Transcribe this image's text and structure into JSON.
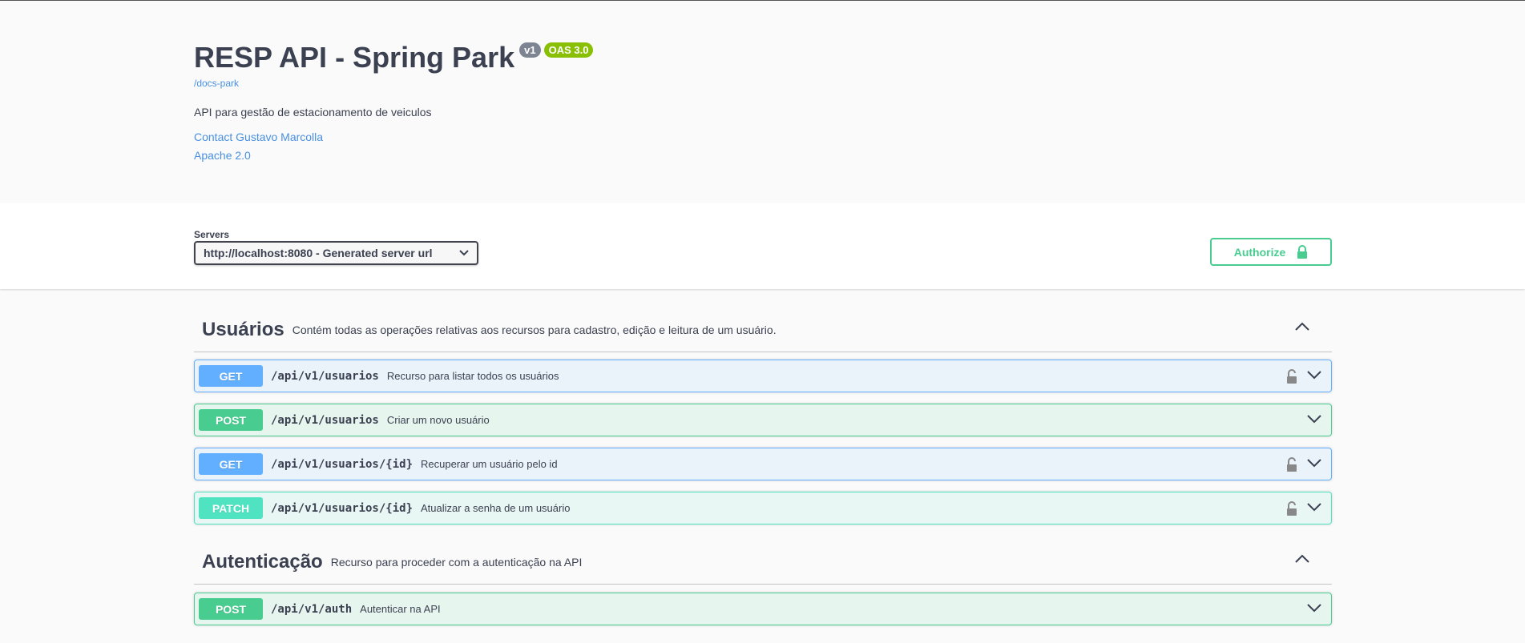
{
  "info": {
    "title": "RESP API - Spring Park",
    "version_badge": "v1",
    "oas_badge": "OAS 3.0",
    "base_url": "/docs-park",
    "description": "API para gestão de estacionamento de veiculos",
    "contact_link": "Contact Gustavo Marcolla",
    "license_link": "Apache 2.0"
  },
  "servers": {
    "label": "Servers",
    "selected": "http://localhost:8080 - Generated server url",
    "authorize_label": "Authorize"
  },
  "tags": [
    {
      "name": "Usuários",
      "description": "Contém todas as operações relativas aos recursos para cadastro, edição e leitura de um usuário.",
      "operations": [
        {
          "method": "GET",
          "path": "/api/v1/usuarios",
          "summary": "Recurso para listar todos os usuários",
          "locked": true
        },
        {
          "method": "POST",
          "path": "/api/v1/usuarios",
          "summary": "Criar um novo usuário",
          "locked": false
        },
        {
          "method": "GET",
          "path": "/api/v1/usuarios/{id}",
          "summary": "Recuperar um usuário pelo id",
          "locked": true
        },
        {
          "method": "PATCH",
          "path": "/api/v1/usuarios/{id}",
          "summary": "Atualizar a senha de um usuário",
          "locked": true
        }
      ]
    },
    {
      "name": "Autenticação",
      "description": "Recurso para proceder com a autenticação na API",
      "operations": [
        {
          "method": "POST",
          "path": "/api/v1/auth",
          "summary": "Autenticar na API",
          "locked": false
        }
      ]
    }
  ],
  "colors": {
    "get": "#61affe",
    "post": "#49cc90",
    "patch": "#50e3c2",
    "link": "#4990e2",
    "text": "#3b4151"
  }
}
